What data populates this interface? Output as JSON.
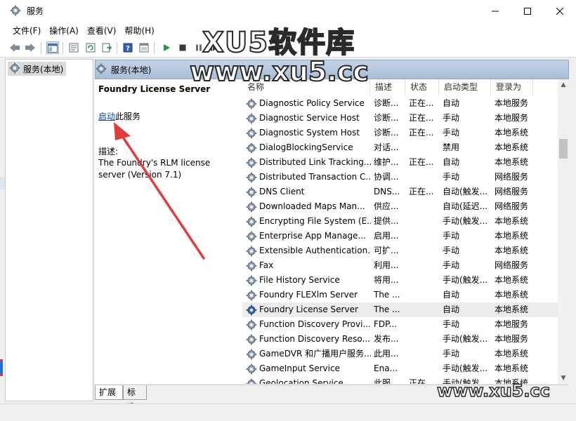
{
  "window": {
    "title": "服务"
  },
  "menu": [
    {
      "label": "文件(F)"
    },
    {
      "label": "操作(A)"
    },
    {
      "label": "查看(V)"
    },
    {
      "label": "帮助(H)"
    }
  ],
  "tree": {
    "root_label": "服务(本地)"
  },
  "pane": {
    "header": "服务(本地)"
  },
  "detail": {
    "service_name": "Foundry License Server",
    "start_link": "启动",
    "start_suffix": "此服务",
    "desc_label": "描述:",
    "description": "The Foundry's RLM license server (Version 7.1)"
  },
  "columns": {
    "name": "名称",
    "desc": "描述",
    "status": "状态",
    "startup_type": "启动类型",
    "logon_as": "登录为"
  },
  "services": [
    {
      "name": "Diagnostic Policy Service",
      "desc": "诊断...",
      "status": "正在...",
      "startup": "自动",
      "logon": "本地服务"
    },
    {
      "name": "Diagnostic Service Host",
      "desc": "诊断...",
      "status": "正在...",
      "startup": "手动",
      "logon": "本地服务"
    },
    {
      "name": "Diagnostic System Host",
      "desc": "诊断...",
      "status": "正在...",
      "startup": "手动",
      "logon": "本地系统"
    },
    {
      "name": "DialogBlockingService",
      "desc": "对话...",
      "status": "",
      "startup": "禁用",
      "logon": "本地系统"
    },
    {
      "name": "Distributed Link Tracking...",
      "desc": "维护...",
      "status": "正在...",
      "startup": "自动",
      "logon": "本地系统"
    },
    {
      "name": "Distributed Transaction C...",
      "desc": "协调...",
      "status": "",
      "startup": "手动",
      "logon": "网络服务"
    },
    {
      "name": "DNS Client",
      "desc": "DNS...",
      "status": "正在...",
      "startup": "自动(触发...",
      "logon": "网络服务"
    },
    {
      "name": "Downloaded Maps Man...",
      "desc": "供应...",
      "status": "",
      "startup": "自动(延迟...",
      "logon": "网络服务"
    },
    {
      "name": "Encrypting File System (E...",
      "desc": "提供...",
      "status": "",
      "startup": "手动(触发...",
      "logon": "本地系统"
    },
    {
      "name": "Enterprise App Manage...",
      "desc": "启用...",
      "status": "",
      "startup": "手动",
      "logon": "本地系统"
    },
    {
      "name": "Extensible Authentication...",
      "desc": "可扩...",
      "status": "",
      "startup": "手动",
      "logon": "本地系统"
    },
    {
      "name": "Fax",
      "desc": "利用...",
      "status": "",
      "startup": "手动",
      "logon": "网络服务"
    },
    {
      "name": "File History Service",
      "desc": "将用...",
      "status": "",
      "startup": "手动(触发...",
      "logon": "本地系统"
    },
    {
      "name": "Foundry FLEXlm Server",
      "desc": "The ...",
      "status": "",
      "startup": "自动",
      "logon": "本地系统"
    },
    {
      "name": "Foundry License Server",
      "desc": "The ...",
      "status": "",
      "startup": "自动",
      "logon": "本地系统",
      "selected": true
    },
    {
      "name": "Function Discovery Provi...",
      "desc": "FDP...",
      "status": "",
      "startup": "手动",
      "logon": "本地服务"
    },
    {
      "name": "Function Discovery Reso...",
      "desc": "发布...",
      "status": "",
      "startup": "手动(触发...",
      "logon": "本地服务"
    },
    {
      "name": "GameDVR 和广播用户服务...",
      "desc": "此用...",
      "status": "",
      "startup": "手动",
      "logon": "本地系统"
    },
    {
      "name": "GameInput Service",
      "desc": "Ena...",
      "status": "",
      "startup": "手动(触发...",
      "logon": "本地系统"
    },
    {
      "name": "Geolocation Service",
      "desc": "此服...",
      "status": "正在...",
      "startup": "手动(触发...",
      "logon": "本地系统"
    }
  ],
  "tabs": [
    {
      "label": "扩展"
    },
    {
      "label": "标准"
    }
  ],
  "watermark": {
    "brand": "XU5软件库",
    "url_top": "www.xu5.cc",
    "url_bottom": "www.xu5.cc"
  },
  "colors": {
    "header_blue": "#a9bfd8",
    "link": "#0645ad",
    "annotation_red": "#e03c3c",
    "play_green": "#1a9e2f"
  }
}
